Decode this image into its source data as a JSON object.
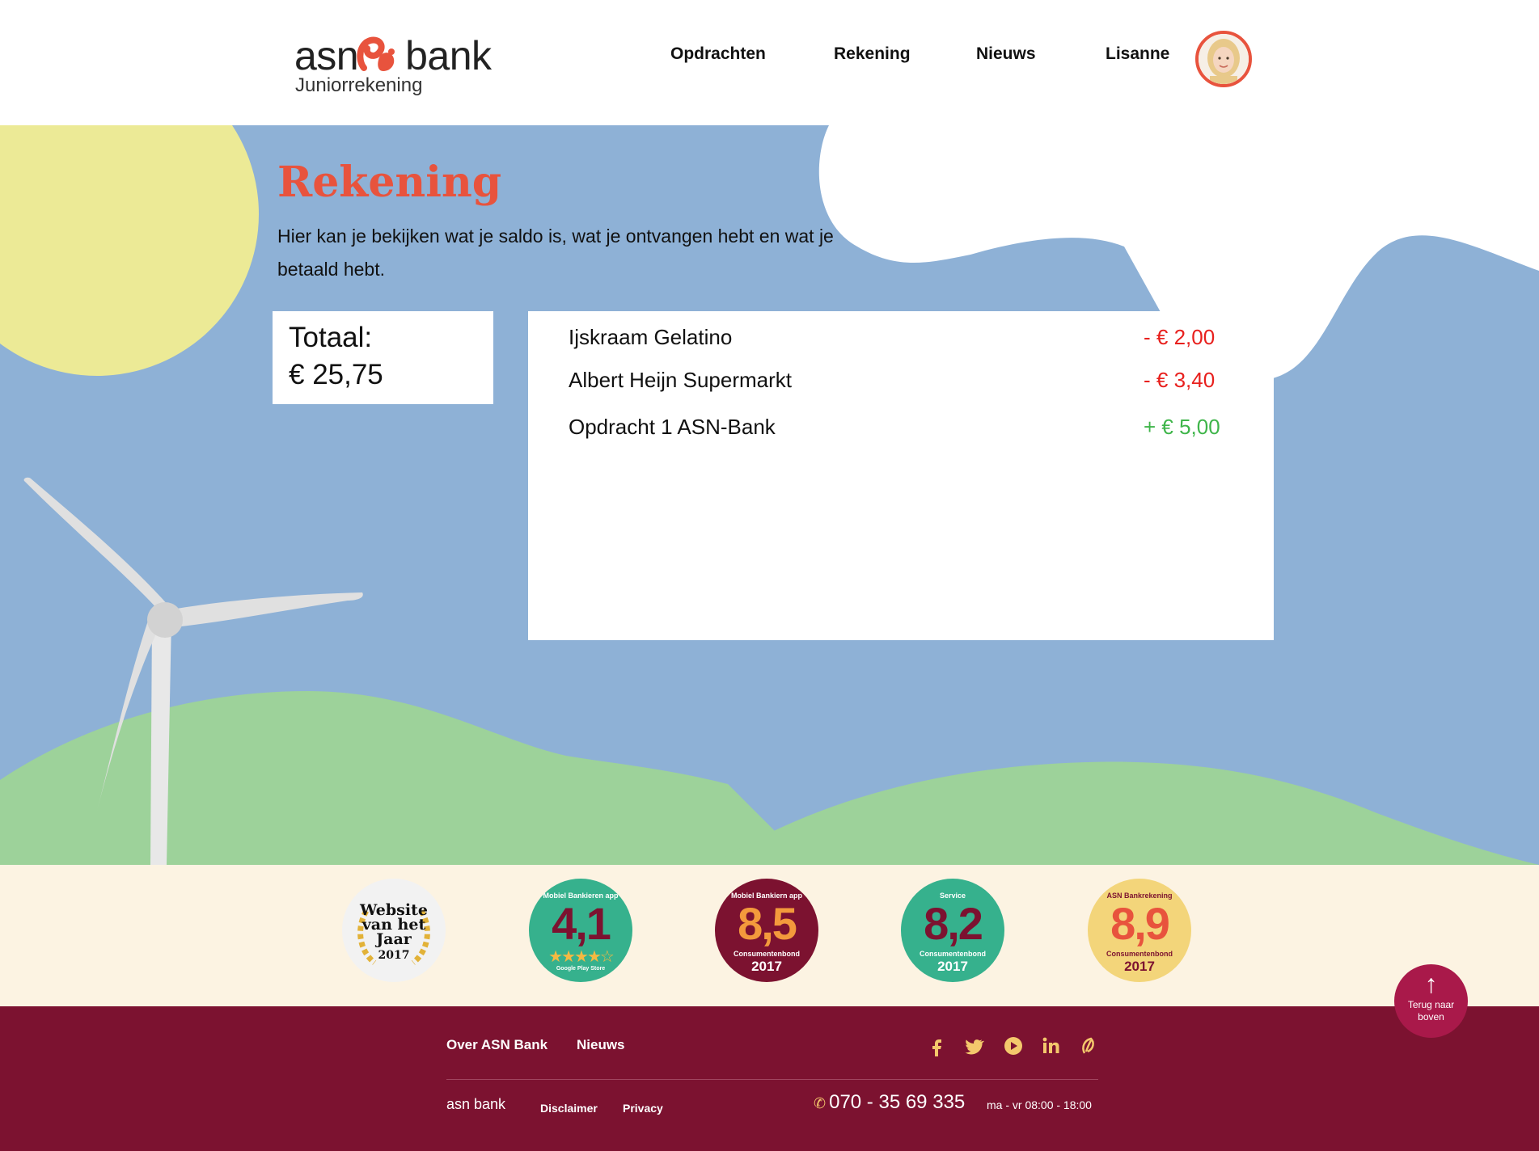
{
  "header": {
    "logo_text_left": "asn",
    "logo_text_right": "bank",
    "logo_subtitle": "Juniorrekening",
    "nav": [
      "Opdrachten",
      "Rekening",
      "Nieuws",
      "Lisanne"
    ]
  },
  "main": {
    "title": "Rekening",
    "intro": "Hier kan je bekijken wat je saldo is, wat je ontvangen hebt en wat je betaald hebt.",
    "total_label": "Totaal:",
    "total_value": "€ 25,75",
    "transactions": [
      {
        "name": "Ijskraam Gelatino",
        "amount": "- € 2,00",
        "color": "#e8201d"
      },
      {
        "name": "Albert Heijn Supermarkt",
        "amount": "- € 3,40",
        "color": "#e8201d"
      },
      {
        "name": "Opdracht 1 ASN-Bank",
        "amount": "+ € 5,00",
        "color": "#3fb54a"
      }
    ]
  },
  "awards": [
    {
      "type": "website",
      "line1": "Website",
      "line2": "van het",
      "line3": "Jaar",
      "year": "2017"
    },
    {
      "type": "score",
      "top": "Mobiel Bankieren app",
      "score": "4,1",
      "stars": "★★★★☆",
      "store": "Google Play Store",
      "bg": "#36b18d",
      "score_color": "#7c1230"
    },
    {
      "type": "score",
      "top": "Mobiel Bankiern app",
      "score": "8,5",
      "sub": "Consumentenbond",
      "year": "2017",
      "bg": "#7c1230",
      "score_color": "#f39a3c"
    },
    {
      "type": "score",
      "top": "Service",
      "score": "8,2",
      "sub": "Consumentenbond",
      "year": "2017",
      "bg": "#36b18d",
      "score_color": "#7c1230"
    },
    {
      "type": "score",
      "top": "ASN Bankrekening",
      "score": "8,9",
      "sub": "Consumentenbond",
      "year": "2017",
      "bg": "#f3d57a",
      "score_color": "#e8533d"
    }
  ],
  "back_to_top": "Terug naar boven",
  "footer": {
    "links_top": [
      "Over ASN Bank",
      "Nieuws"
    ],
    "logo": "asn bank",
    "links_bottom": [
      "Disclaimer",
      "Privacy"
    ],
    "phone": "070 - 35 69 335",
    "hours": "ma - vr 08:00 - 18:00",
    "social_icons": [
      "facebook-icon",
      "twitter-icon",
      "youtube-icon",
      "linkedin-icon",
      "asn-leaf-icon"
    ]
  },
  "colors": {
    "accent": "#e8533d",
    "sky": "#8eb1d6",
    "sun": "#ecea96",
    "hills": "#9dd29a",
    "footer": "#7c1230",
    "cream": "#fcf3e2",
    "negative": "#e8201d",
    "positive": "#3fb54a"
  }
}
